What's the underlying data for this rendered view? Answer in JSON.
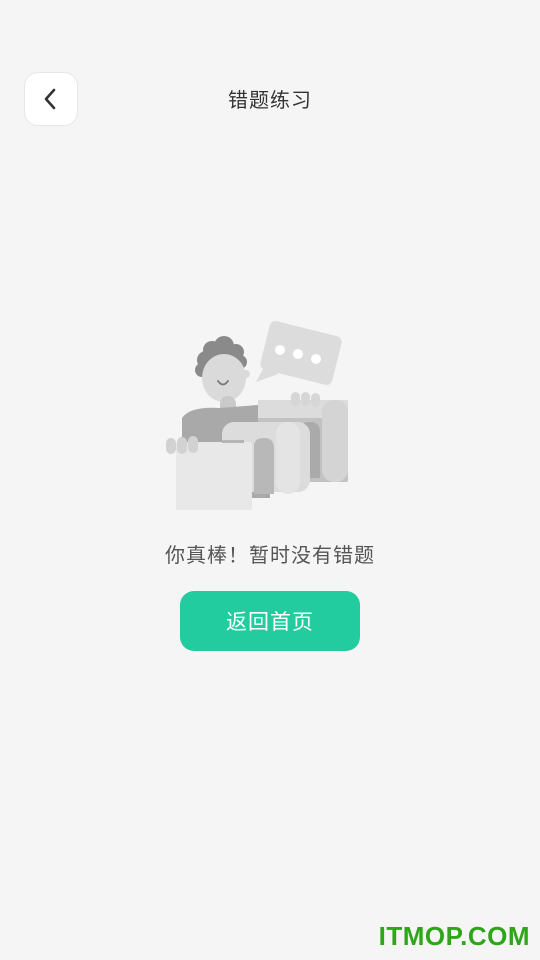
{
  "header": {
    "title": "错题练习",
    "back_icon": "chevron-left-icon"
  },
  "empty_state": {
    "illustration": "person-with-boxes-and-speech-bubble-illustration",
    "message": "你真棒！暂时没有错题"
  },
  "actions": {
    "home_label": "返回首页"
  },
  "watermark": {
    "text": "ITMOP.COM"
  },
  "colors": {
    "background": "#f5f5f5",
    "accent": "#22cc9e",
    "watermark": "#2fa61a"
  }
}
